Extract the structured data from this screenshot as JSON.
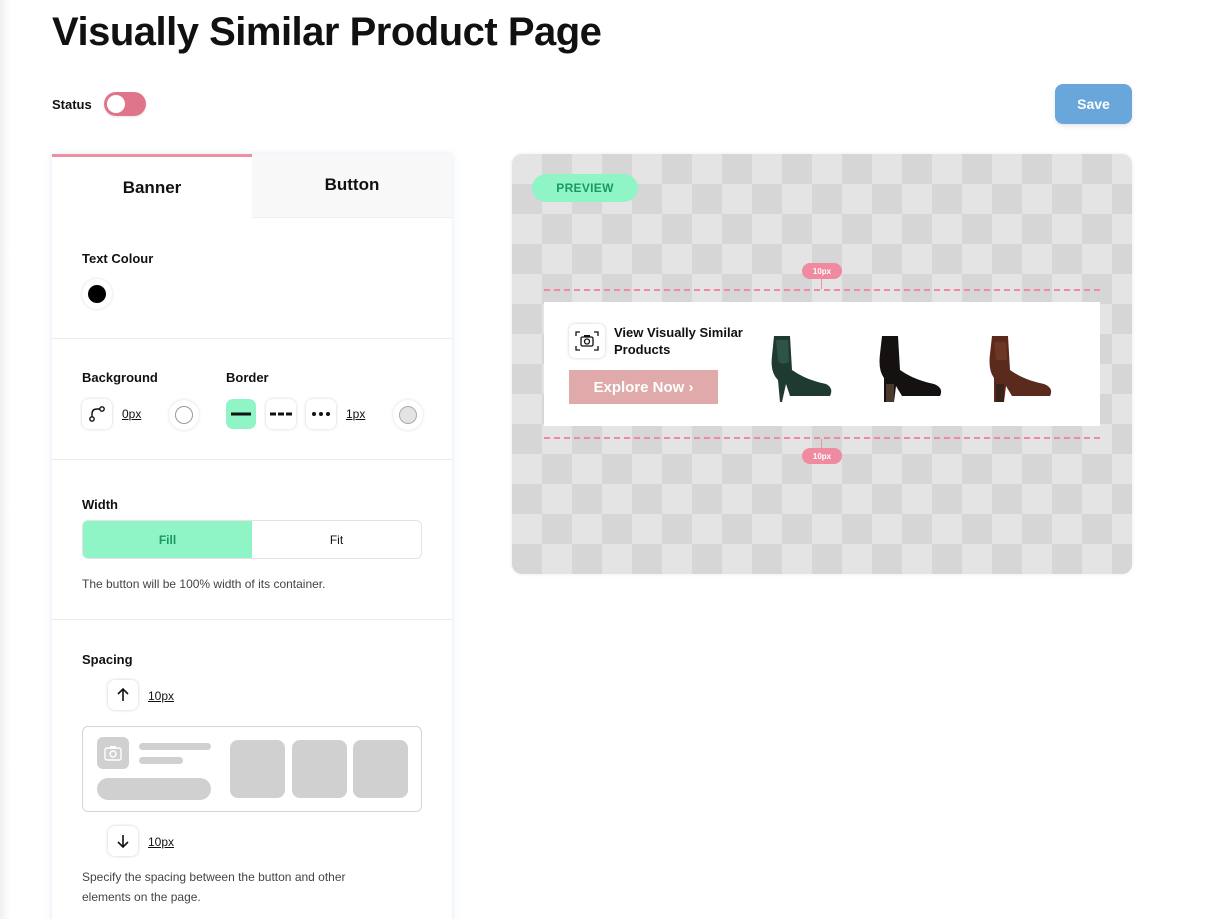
{
  "page": {
    "title": "Visually Similar Product Page"
  },
  "header": {
    "status_label": "Status",
    "status_toggle_on": false,
    "save_label": "Save"
  },
  "tabs": [
    {
      "label": "Banner",
      "active": true
    },
    {
      "label": "Button",
      "active": false
    }
  ],
  "text_colour": {
    "title": "Text Colour",
    "color": "#000000"
  },
  "background": {
    "title": "Background",
    "radius_value": "0px"
  },
  "border": {
    "title": "Border",
    "width_value": "1px",
    "styles": [
      "solid",
      "dashed",
      "dotted"
    ],
    "selected_style": "solid"
  },
  "width": {
    "title": "Width",
    "options": [
      "Fill",
      "Fit"
    ],
    "selected": "Fill",
    "help": "The button will be 100% width of its container."
  },
  "spacing": {
    "title": "Spacing",
    "top_value": "10px",
    "bottom_value": "10px",
    "help": "Specify the spacing between the button and other elements on the page."
  },
  "preview": {
    "badge": "PREVIEW",
    "top_spacing_label": "10px",
    "bottom_spacing_label": "10px",
    "banner_text": "View Visually Similar Products",
    "button_label": "Explore Now ›",
    "products": [
      "green-ankle-boot",
      "black-ankle-boot",
      "brown-ankle-boot"
    ]
  },
  "colors": {
    "accent_pink": "#e07489",
    "save_blue": "#69a7da",
    "mint": "#8ff5c7",
    "explore_button": "#dfaaa9"
  }
}
